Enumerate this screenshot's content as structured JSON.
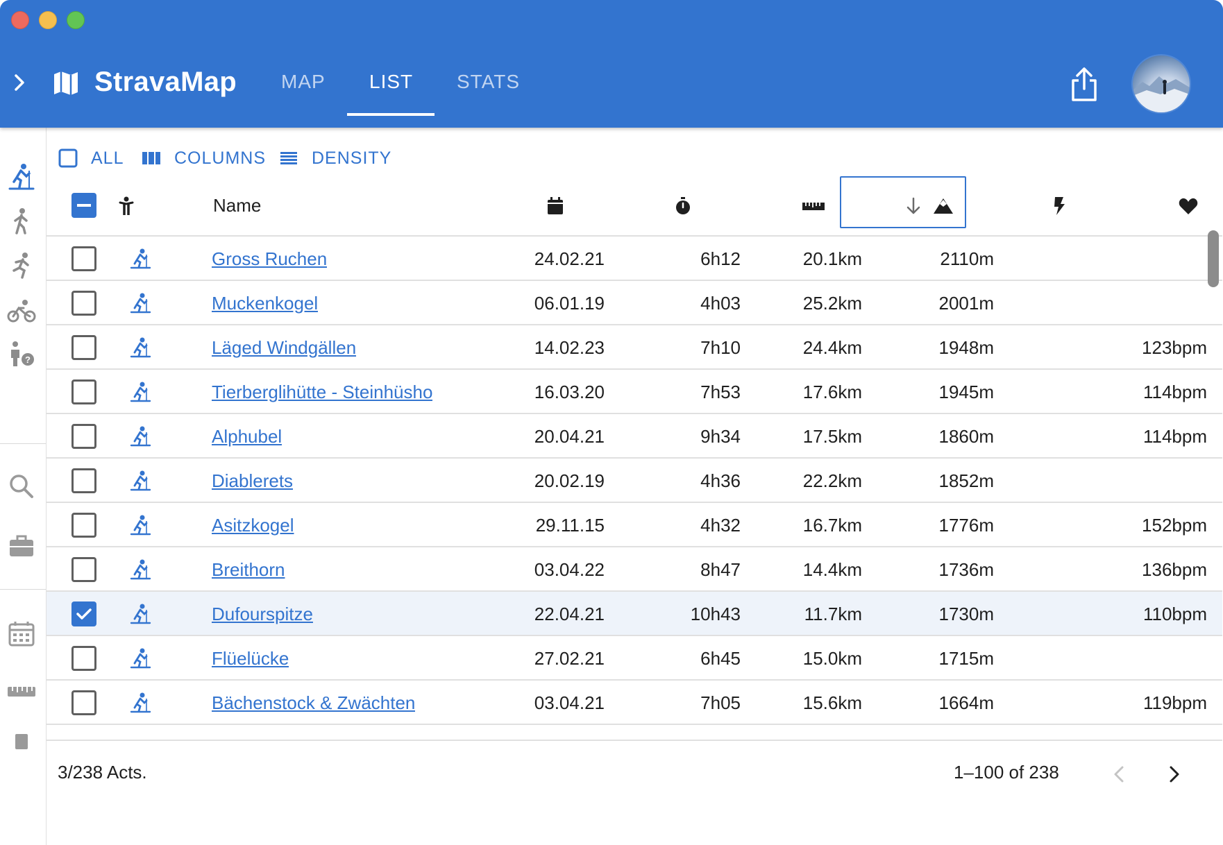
{
  "app": {
    "title": "StravaMap",
    "tabs": [
      "MAP",
      "LIST",
      "STATS"
    ],
    "active_tab": "LIST",
    "accent_color": "#3374cf"
  },
  "toolbar": {
    "all_label": "ALL",
    "columns_label": "COLUMNS",
    "density_label": "DENSITY"
  },
  "table": {
    "name_header": "Name",
    "header_icons": [
      "activity-type-icon",
      "calendar-icon",
      "stopwatch-icon",
      "ruler-icon",
      "elevation-icon",
      "power-icon",
      "heart-icon"
    ],
    "sort": {
      "column": "elevation",
      "direction": "descending"
    },
    "rows": [
      {
        "name": "Gross Ruchen",
        "date": "24.02.21",
        "duration": "6h12",
        "distance": "20.1km",
        "elevation": "2110m",
        "hr": "",
        "checked": false
      },
      {
        "name": "Muckenkogel",
        "date": "06.01.19",
        "duration": "4h03",
        "distance": "25.2km",
        "elevation": "2001m",
        "hr": "",
        "checked": false
      },
      {
        "name": "Läged Windgällen",
        "date": "14.02.23",
        "duration": "7h10",
        "distance": "24.4km",
        "elevation": "1948m",
        "hr": "123bpm",
        "checked": false
      },
      {
        "name": "Tierberglihütte - Steinhüsho",
        "date": "16.03.20",
        "duration": "7h53",
        "distance": "17.6km",
        "elevation": "1945m",
        "hr": "114bpm",
        "checked": false
      },
      {
        "name": "Alphubel",
        "date": "20.04.21",
        "duration": "9h34",
        "distance": "17.5km",
        "elevation": "1860m",
        "hr": "114bpm",
        "checked": false
      },
      {
        "name": "Diablerets",
        "date": "20.02.19",
        "duration": "4h36",
        "distance": "22.2km",
        "elevation": "1852m",
        "hr": "",
        "checked": false
      },
      {
        "name": "Asitzkogel",
        "date": "29.11.15",
        "duration": "4h32",
        "distance": "16.7km",
        "elevation": "1776m",
        "hr": "152bpm",
        "checked": false
      },
      {
        "name": "Breithorn",
        "date": "03.04.22",
        "duration": "8h47",
        "distance": "14.4km",
        "elevation": "1736m",
        "hr": "136bpm",
        "checked": false
      },
      {
        "name": "Dufourspitze",
        "date": "22.04.21",
        "duration": "10h43",
        "distance": "11.7km",
        "elevation": "1730m",
        "hr": "110bpm",
        "checked": true
      },
      {
        "name": "Flüelücke",
        "date": "27.02.21",
        "duration": "6h45",
        "distance": "15.0km",
        "elevation": "1715m",
        "hr": "",
        "checked": false
      },
      {
        "name": "Bächenstock & Zwächten",
        "date": "03.04.21",
        "duration": "7h05",
        "distance": "15.6km",
        "elevation": "1664m",
        "hr": "119bpm",
        "checked": false
      }
    ]
  },
  "footer": {
    "selected_count": "3/238 Acts.",
    "range": "1–100 of 238"
  },
  "siderail": {
    "icons": [
      "ski-touring-icon",
      "hiking-icon",
      "running-icon",
      "cycling-icon",
      "other-activity-icon",
      "search-icon",
      "briefcase-icon",
      "calendar-icon",
      "ruler-icon"
    ]
  }
}
